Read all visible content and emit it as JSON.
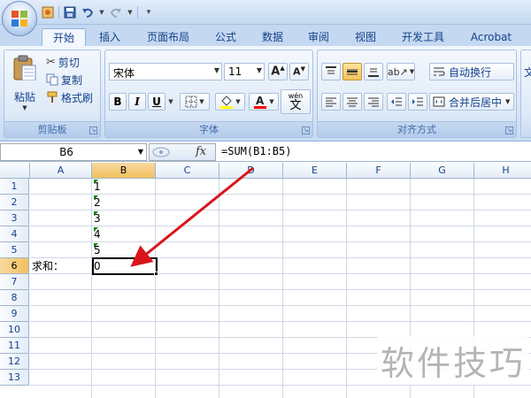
{
  "ribbon_tabs": [
    "开始",
    "插入",
    "页面布局",
    "公式",
    "数据",
    "审阅",
    "视图",
    "开发工具",
    "Acrobat"
  ],
  "clipboard": {
    "paste_label": "粘贴",
    "cut_label": "剪切",
    "copy_label": "复制",
    "format_painter_label": "格式刷",
    "group_label": "剪贴板"
  },
  "font": {
    "font_name": "宋体",
    "font_size": "11",
    "bold": "B",
    "italic": "I",
    "underline": "U",
    "wen_label": "wén",
    "wen_char": "文",
    "group_label": "字体"
  },
  "alignment": {
    "wrap_text_label": "自动换行",
    "merge_center_label": "合并后居中",
    "group_label": "对齐方式"
  },
  "formula_bar": {
    "name_box": "B6",
    "fx": "fx",
    "formula": "=SUM(B1:B5)"
  },
  "columns": [
    "A",
    "B",
    "C",
    "D",
    "E",
    "F",
    "G",
    "H"
  ],
  "rows": [
    "1",
    "2",
    "3",
    "4",
    "5",
    "6",
    "7",
    "8",
    "9",
    "10",
    "11",
    "12",
    "13"
  ],
  "cells": {
    "B1": "1",
    "B2": "2",
    "B3": "3",
    "B4": "4",
    "B5": "5",
    "A6": "求和：",
    "B6": "0"
  },
  "selected_cell": "B6",
  "watermark": "软件技巧",
  "colors": {
    "annotation_arrow": "#d9141c",
    "text_number_indicator": "#008000",
    "ribbon_text": "#15428b"
  }
}
